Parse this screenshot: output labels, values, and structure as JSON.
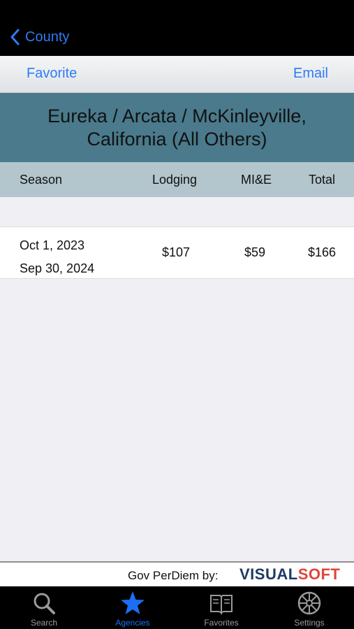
{
  "nav": {
    "back_label": "County"
  },
  "toolbar": {
    "favorite_label": "Favorite",
    "email_label": "Email"
  },
  "location": {
    "title": "Eureka / Arcata / McKinleyville, California (All Others)"
  },
  "table": {
    "columns": {
      "season": "Season",
      "lodging": "Lodging",
      "mie": "MI&E",
      "total": "Total"
    },
    "rows": [
      {
        "start": "Oct 1, 2023",
        "end": "Sep 30, 2024",
        "lodging": "$107",
        "mie": "$59",
        "total": "$166"
      }
    ]
  },
  "credit": {
    "text": "Gov PerDiem by:",
    "brand_part1": "VISUAL",
    "brand_part2": "SOFT"
  },
  "tabs": [
    {
      "label": "Search",
      "icon": "magnifier-icon",
      "active": false
    },
    {
      "label": "Agencies",
      "icon": "star-icon",
      "active": true
    },
    {
      "label": "Favorites",
      "icon": "book-icon",
      "active": false
    },
    {
      "label": "Settings",
      "icon": "gear-icon",
      "active": false
    }
  ],
  "colors": {
    "accent": "#2f7bf5",
    "title_band": "#4a7a8c",
    "header_band": "#b3c6cd",
    "tab_active": "#1c6ff4"
  }
}
